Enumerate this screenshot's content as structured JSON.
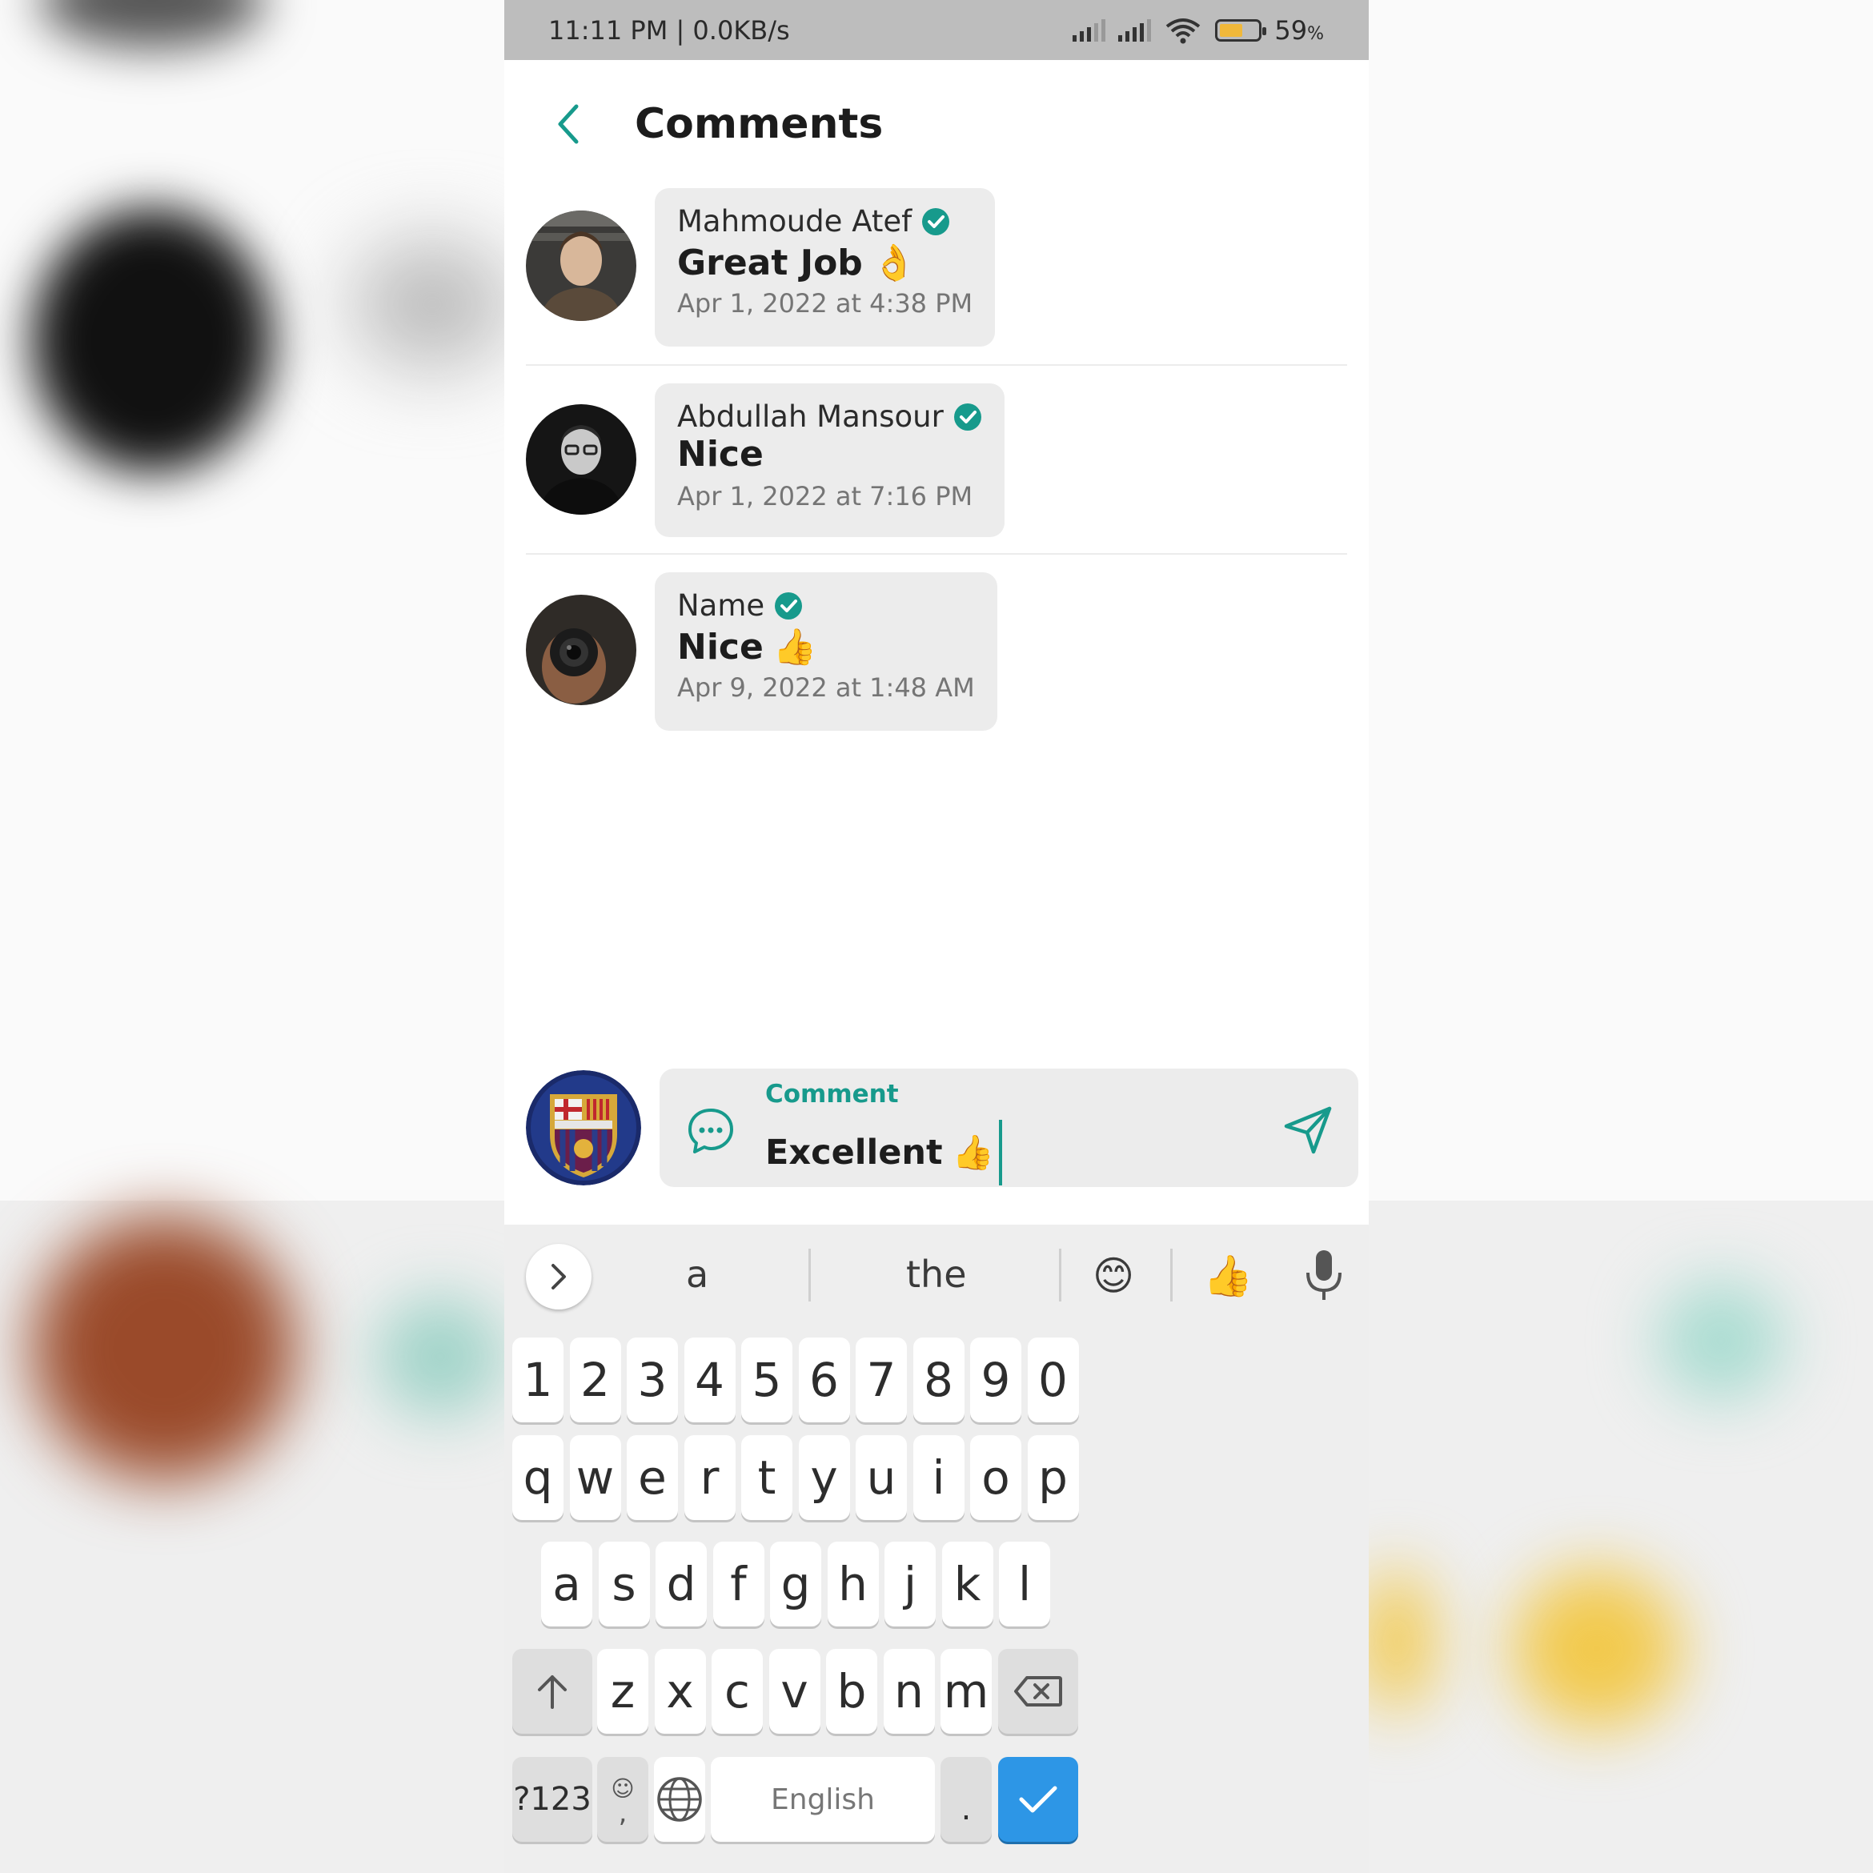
{
  "status_bar": {
    "time_speed": "11:11 PM | 0.0KB/s",
    "battery_percent": "59",
    "battery_unit": "%",
    "battery_level": 0.59
  },
  "header": {
    "title": "Comments"
  },
  "comments": [
    {
      "author": "Mahmoude Atef",
      "text": "Great Job",
      "emoji": "👌",
      "timestamp": "Apr 1, 2022 at 4:38 PM"
    },
    {
      "author": "Abdullah Mansour",
      "text": "Nice",
      "emoji": "",
      "timestamp": "Apr 1, 2022 at 7:16 PM"
    },
    {
      "author": "Name",
      "text": "Nice",
      "emoji": "👍",
      "timestamp": "Apr 9, 2022 at 1:48 AM"
    }
  ],
  "composer": {
    "label": "Comment",
    "value": "Excellent",
    "value_emoji": "👍"
  },
  "keyboard": {
    "suggestions": [
      "a",
      "the",
      "😊",
      "👍"
    ],
    "row_numbers": [
      "1",
      "2",
      "3",
      "4",
      "5",
      "6",
      "7",
      "8",
      "9",
      "0"
    ],
    "row_1": [
      "q",
      "w",
      "e",
      "r",
      "t",
      "y",
      "u",
      "i",
      "o",
      "p"
    ],
    "row_2": [
      "a",
      "s",
      "d",
      "f",
      "g",
      "h",
      "j",
      "k",
      "l"
    ],
    "row_3": [
      "z",
      "x",
      "c",
      "v",
      "b",
      "n",
      "m"
    ],
    "symbols_label": "?123",
    "comma_label": ",",
    "space_label": "English",
    "period_label": "."
  },
  "colors": {
    "accent": "#179a8c",
    "enter_key": "#2d96e6",
    "bubble": "#ececec"
  }
}
